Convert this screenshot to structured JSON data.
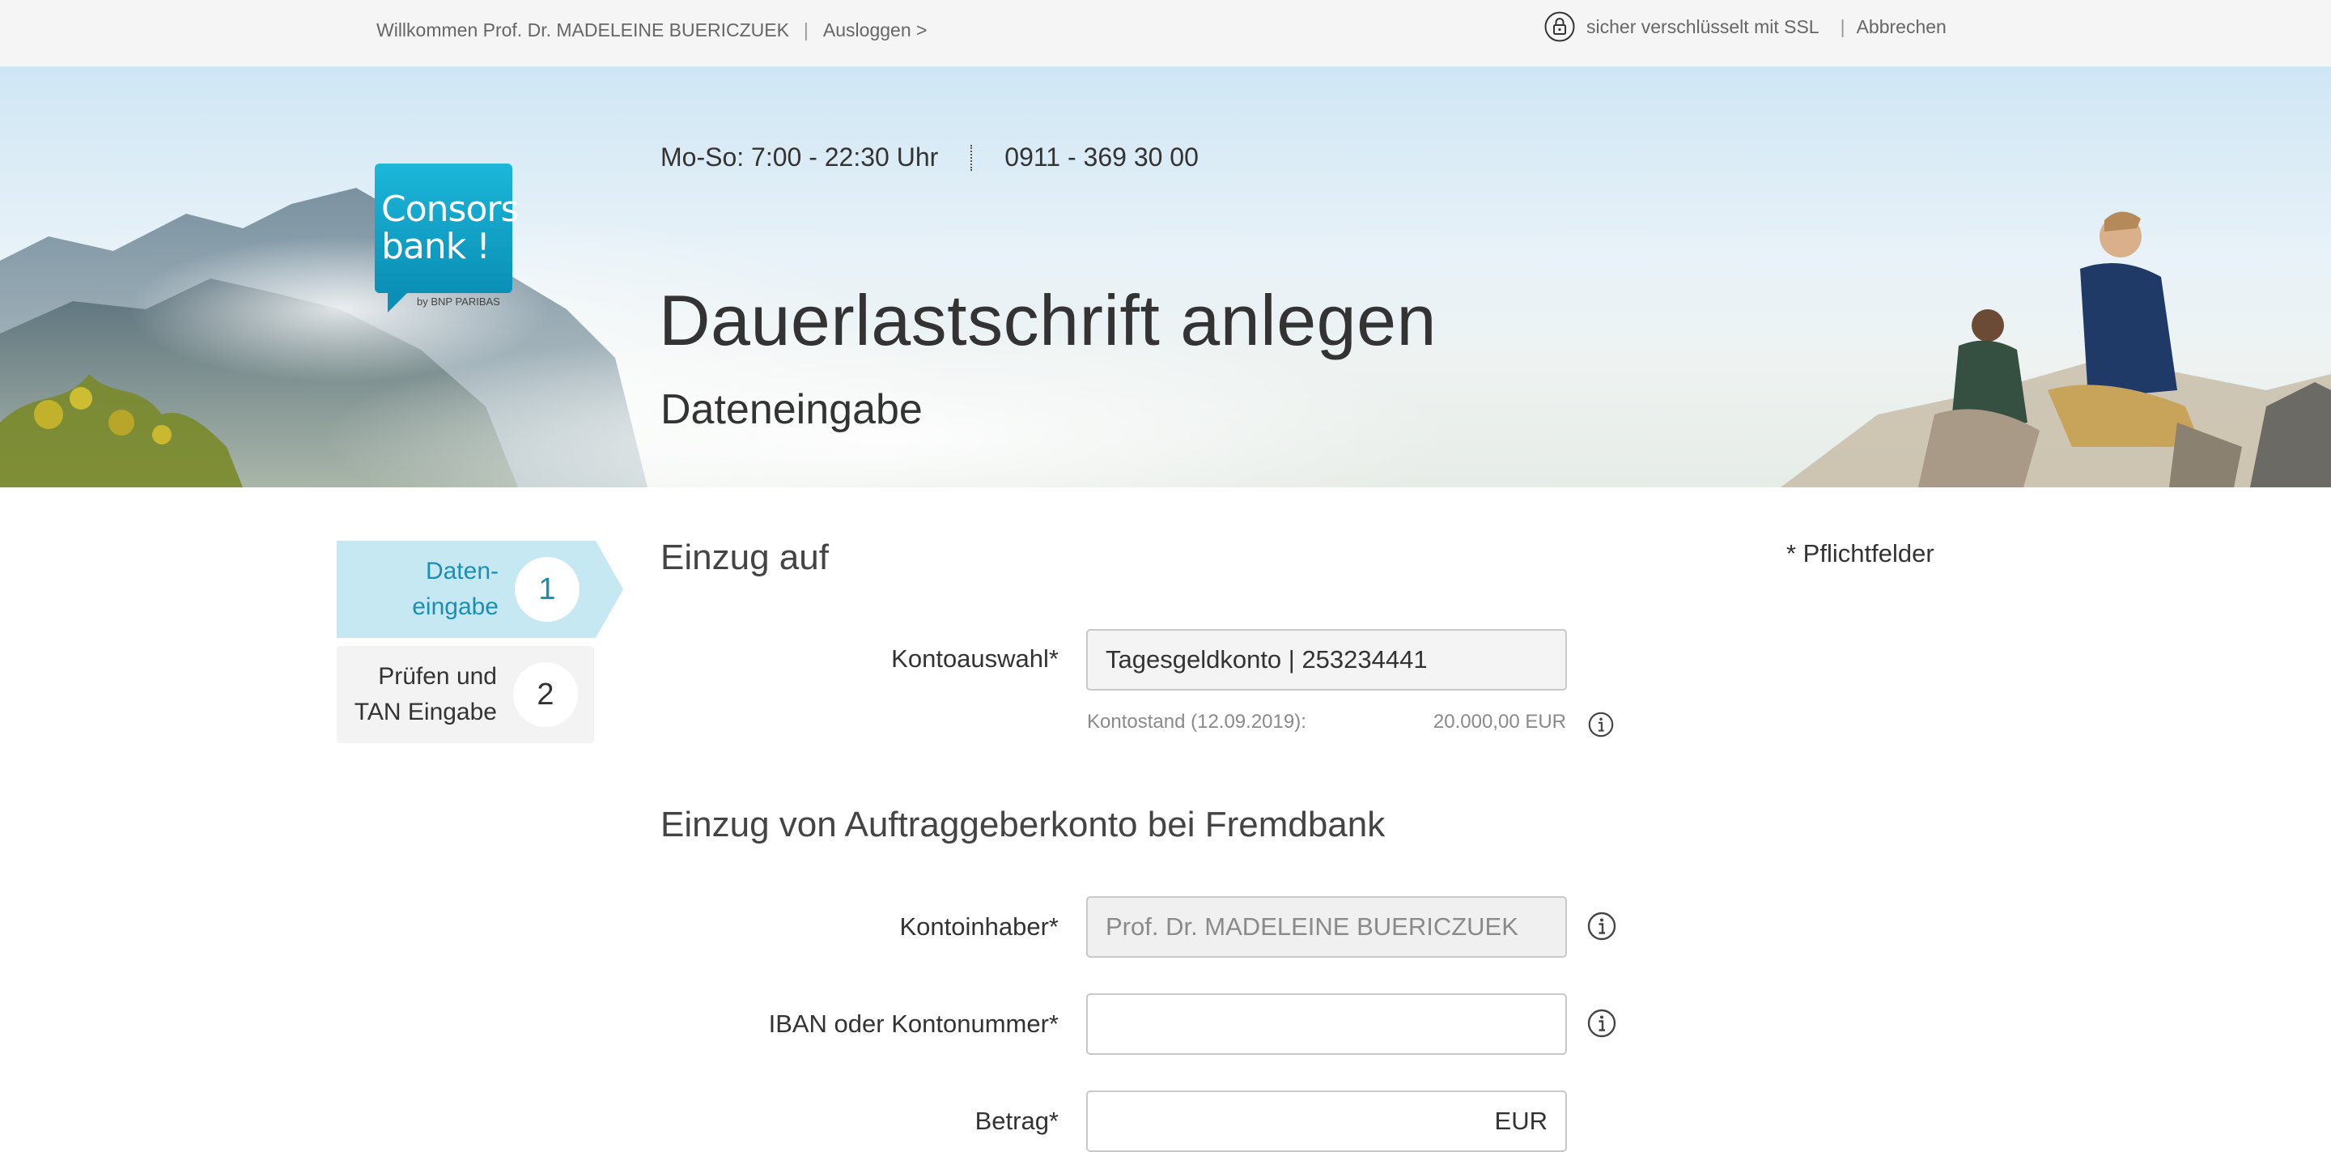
{
  "topbar": {
    "welcome": "Willkommen Prof. Dr. MADELEINE BUERICZUEK",
    "separator": "|",
    "logout": "Ausloggen >",
    "ssl_text": "sicher verschlüsselt mit SSL",
    "cancel": "Abbrechen"
  },
  "logo": {
    "line1": "Consors",
    "line2": "bank !",
    "sub": "by BNP PARIBAS"
  },
  "header": {
    "hours": "Mo-So: 7:00 - 22:30 Uhr",
    "phone": "0911 - 369 30 00",
    "title": "Dauerlastschrift anlegen",
    "subtitle": "Dateneingabe"
  },
  "steps": [
    {
      "line1": "Daten-",
      "line2": "eingabe",
      "number": "1",
      "active": true
    },
    {
      "line1": "Prüfen und",
      "line2": "TAN Eingabe",
      "number": "2",
      "active": false
    }
  ],
  "required_note": "* Pflichtfelder",
  "section1": {
    "title": "Einzug auf",
    "account_label": "Kontoauswahl*",
    "account_value": "Tagesgeldkonto | 253234441",
    "balance_label": "Kontostand (12.09.2019):",
    "balance_value": "20.000,00 EUR"
  },
  "section2": {
    "title": "Einzug von Auftraggeberkonto bei Fremdbank",
    "holder_label": "Kontoinhaber*",
    "holder_value": "Prof. Dr. MADELEINE BUERICZUEK",
    "iban_label": "IBAN oder Kontonummer*",
    "iban_value": "",
    "amount_label": "Betrag*",
    "amount_currency": "EUR"
  },
  "colors": {
    "accent": "#1a8fb3",
    "step_active_bg": "#c6e8f2",
    "logo_bg": "#1bb7d9"
  },
  "icons": {
    "lock": "lock-icon",
    "info": "info-icon"
  }
}
